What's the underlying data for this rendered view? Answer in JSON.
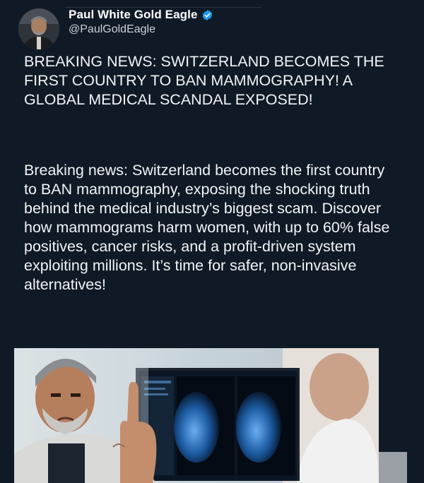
{
  "author": {
    "display_name": "Paul White Gold Eagle",
    "handle": "@PaulGoldEagle",
    "verified": true
  },
  "post": {
    "headline": "BREAKING NEWS: SWITZERLAND BECOMES THE FIRST COUNTRY TO BAN MAMMOGRAPHY! A GLOBAL MEDICAL SCANDAL EXPOSED!",
    "body": "Breaking news: Switzerland becomes the first country to BAN mammography, exposing the shocking truth behind the medical industry’s biggest scam. Discover how mammograms harm women, with up to 60% false positives, cancer risks, and a profit-driven system exploiting millions. It’s time for safer, non-invasive alternatives!"
  },
  "icons": {
    "verified": "verified-badge-icon"
  },
  "colors": {
    "background": "#101a26",
    "text": "#f2f4f7",
    "handle": "#c9d1da",
    "verified": "#1d9bf0"
  }
}
